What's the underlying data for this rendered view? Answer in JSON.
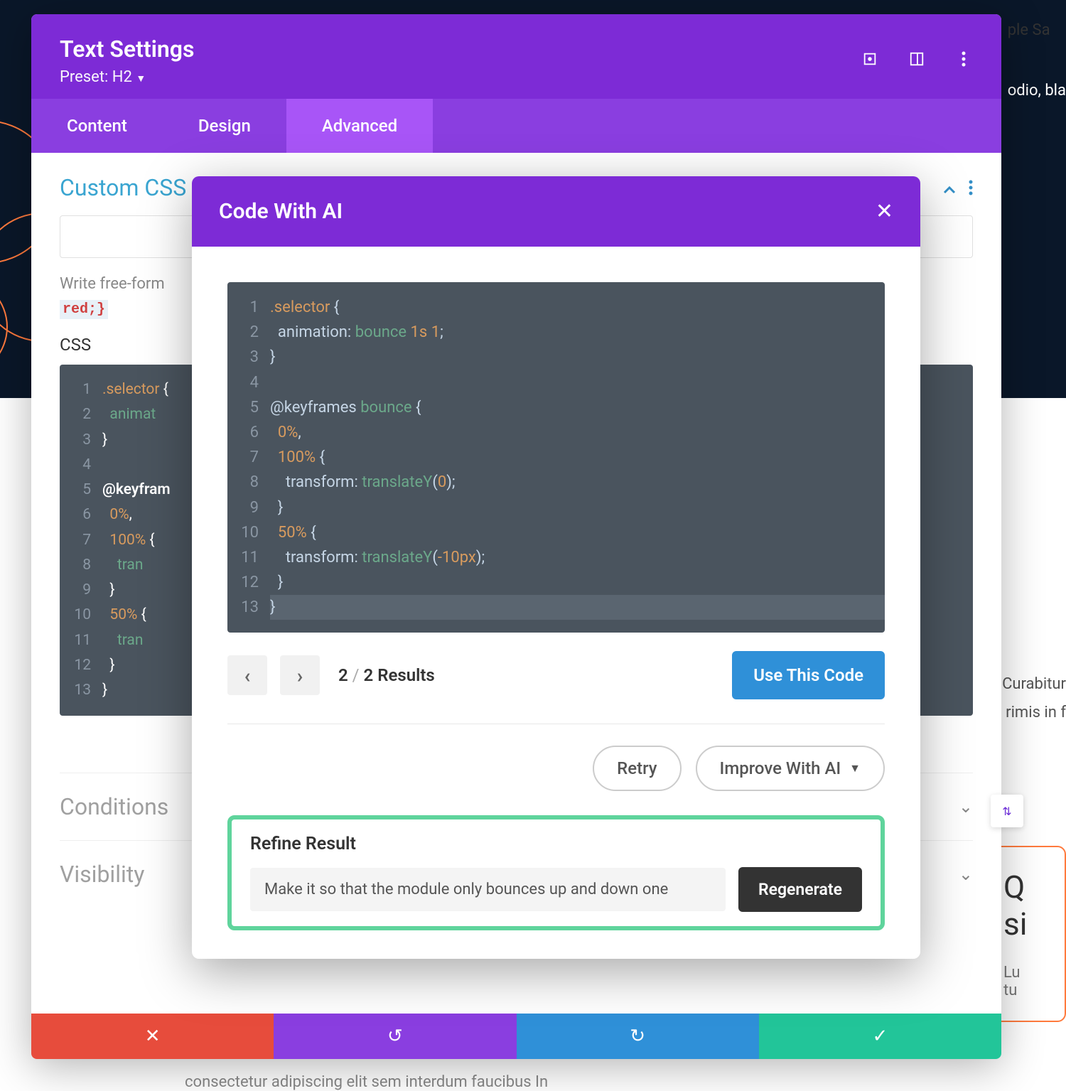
{
  "panel": {
    "title": "Text Settings",
    "preset_label": "Preset: H2",
    "tabs": {
      "content": "Content",
      "design": "Design",
      "advanced": "Advanced"
    }
  },
  "customcss": {
    "heading": "Custom CSS",
    "help_prefix": "Write free-form",
    "help_code": "red;}",
    "label": "CSS"
  },
  "editor_bg": {
    "lines": [
      {
        "n": "1",
        "seg": [
          {
            "t": ".selector",
            "c": "tok-sel"
          },
          {
            "t": " {",
            "c": ""
          }
        ]
      },
      {
        "n": "2",
        "seg": [
          {
            "t": "  ",
            "c": ""
          },
          {
            "t": "animat",
            "c": "tok-val"
          }
        ]
      },
      {
        "n": "3",
        "seg": [
          {
            "t": "}",
            "c": ""
          }
        ]
      },
      {
        "n": "4",
        "seg": [
          {
            "t": "",
            "c": ""
          }
        ]
      },
      {
        "n": "5",
        "seg": [
          {
            "t": "@keyfram",
            "c": "tok-kw"
          }
        ]
      },
      {
        "n": "6",
        "seg": [
          {
            "t": "  ",
            "c": ""
          },
          {
            "t": "0%",
            "c": "tok-pct"
          },
          {
            "t": ",",
            "c": ""
          }
        ]
      },
      {
        "n": "7",
        "seg": [
          {
            "t": "  ",
            "c": ""
          },
          {
            "t": "100%",
            "c": "tok-pct"
          },
          {
            "t": " {",
            "c": ""
          }
        ]
      },
      {
        "n": "8",
        "seg": [
          {
            "t": "    ",
            "c": ""
          },
          {
            "t": "tran",
            "c": "tok-val"
          }
        ]
      },
      {
        "n": "9",
        "seg": [
          {
            "t": "  }",
            "c": ""
          }
        ]
      },
      {
        "n": "10",
        "seg": [
          {
            "t": "  ",
            "c": ""
          },
          {
            "t": "50%",
            "c": "tok-pct"
          },
          {
            "t": " {",
            "c": ""
          }
        ]
      },
      {
        "n": "11",
        "seg": [
          {
            "t": "    ",
            "c": ""
          },
          {
            "t": "tran",
            "c": "tok-val"
          }
        ]
      },
      {
        "n": "12",
        "seg": [
          {
            "t": "  }",
            "c": ""
          }
        ]
      },
      {
        "n": "13",
        "seg": [
          {
            "t": "}",
            "c": ""
          }
        ]
      }
    ]
  },
  "accordion": {
    "conditions": "Conditions",
    "visibility": "Visibility"
  },
  "ai": {
    "title": "Code With AI",
    "lines": [
      {
        "n": "1",
        "seg": [
          {
            "t": ".selector",
            "c": "tok-sel"
          },
          {
            "t": " {",
            "c": "tok-punc"
          }
        ]
      },
      {
        "n": "2",
        "seg": [
          {
            "t": "  ",
            "c": ""
          },
          {
            "t": "animation",
            "c": "tok-prop"
          },
          {
            "t": ": ",
            "c": "tok-punc"
          },
          {
            "t": "bounce",
            "c": "tok-val"
          },
          {
            "t": " ",
            "c": ""
          },
          {
            "t": "1s",
            "c": "tok-sel"
          },
          {
            "t": " ",
            "c": ""
          },
          {
            "t": "1",
            "c": "tok-sel"
          },
          {
            "t": ";",
            "c": "tok-punc"
          }
        ]
      },
      {
        "n": "3",
        "seg": [
          {
            "t": "}",
            "c": "tok-punc"
          }
        ]
      },
      {
        "n": "4",
        "seg": [
          {
            "t": "",
            "c": ""
          }
        ]
      },
      {
        "n": "5",
        "seg": [
          {
            "t": "@keyframes",
            "c": "tok-prop"
          },
          {
            "t": " ",
            "c": ""
          },
          {
            "t": "bounce",
            "c": "tok-val"
          },
          {
            "t": " {",
            "c": "tok-punc"
          }
        ]
      },
      {
        "n": "6",
        "seg": [
          {
            "t": "  ",
            "c": ""
          },
          {
            "t": "0%",
            "c": "tok-sel"
          },
          {
            "t": ",",
            "c": "tok-punc"
          }
        ]
      },
      {
        "n": "7",
        "seg": [
          {
            "t": "  ",
            "c": ""
          },
          {
            "t": "100%",
            "c": "tok-sel"
          },
          {
            "t": " {",
            "c": "tok-punc"
          }
        ]
      },
      {
        "n": "8",
        "seg": [
          {
            "t": "    ",
            "c": ""
          },
          {
            "t": "transform",
            "c": "tok-prop"
          },
          {
            "t": ": ",
            "c": "tok-punc"
          },
          {
            "t": "translateY",
            "c": "tok-val"
          },
          {
            "t": "(",
            "c": "tok-punc"
          },
          {
            "t": "0",
            "c": "tok-sel"
          },
          {
            "t": ");",
            "c": "tok-punc"
          }
        ]
      },
      {
        "n": "9",
        "seg": [
          {
            "t": "  }",
            "c": "tok-punc"
          }
        ]
      },
      {
        "n": "10",
        "seg": [
          {
            "t": "  ",
            "c": ""
          },
          {
            "t": "50%",
            "c": "tok-sel"
          },
          {
            "t": " {",
            "c": "tok-punc"
          }
        ]
      },
      {
        "n": "11",
        "seg": [
          {
            "t": "    ",
            "c": ""
          },
          {
            "t": "transform",
            "c": "tok-prop"
          },
          {
            "t": ": ",
            "c": "tok-punc"
          },
          {
            "t": "translateY",
            "c": "tok-val"
          },
          {
            "t": "(",
            "c": "tok-punc"
          },
          {
            "t": "-10px",
            "c": "tok-sel"
          },
          {
            "t": ");",
            "c": "tok-punc"
          }
        ]
      },
      {
        "n": "12",
        "seg": [
          {
            "t": "  }",
            "c": "tok-punc"
          }
        ]
      },
      {
        "n": "13",
        "seg": [
          {
            "t": "}",
            "c": "tok-punc"
          }
        ]
      }
    ],
    "results": {
      "current": "2",
      "sep": " / ",
      "total": "2 Results"
    },
    "use_code": "Use This Code",
    "retry": "Retry",
    "improve": "Improve With AI",
    "refine_title": "Refine Result",
    "refine_value": "Make it so that the module only bounces up and down one",
    "regenerate": "Regenerate"
  },
  "bg": {
    "top1": "ple     Sa",
    "top2": "odio, bla",
    "mid1": "Curabitur",
    "mid2": "rimis in f",
    "card1": "Q",
    "card2": "si",
    "card3": "Lu",
    "card4": "tu",
    "lorem": "consectetur adipiscing elit          sem interdum faucibus  In"
  }
}
